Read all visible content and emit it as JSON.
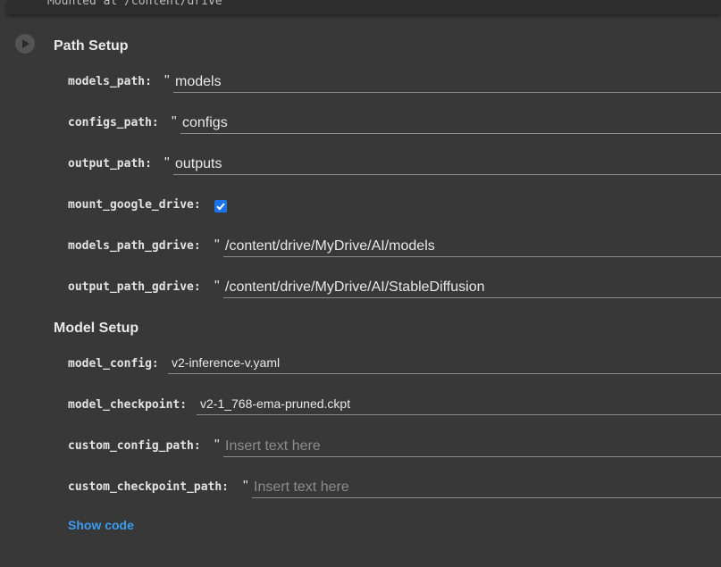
{
  "previous_output": {
    "text": "Mounted at /content/drive"
  },
  "cell": {
    "run_button_icon": "play-icon",
    "path_setup": {
      "title": "Path Setup",
      "models_path": {
        "label": "models_path:",
        "value": "models"
      },
      "configs_path": {
        "label": "configs_path:",
        "value": "configs"
      },
      "output_path": {
        "label": "output_path:",
        "value": "outputs"
      },
      "mount_google_drive": {
        "label": "mount_google_drive:",
        "checked": true
      },
      "models_path_gdrive": {
        "label": "models_path_gdrive:",
        "value": "/content/drive/MyDrive/AI/models"
      },
      "output_path_gdrive": {
        "label": "output_path_gdrive:",
        "value": "/content/drive/MyDrive/AI/StableDiffusion"
      }
    },
    "model_setup": {
      "title": "Model Setup",
      "model_config": {
        "label": "model_config:",
        "value": "v2-inference-v.yaml"
      },
      "model_checkpoint": {
        "label": "model_checkpoint:",
        "value": "v2-1_768-ema-pruned.ckpt"
      },
      "custom_config_path": {
        "label": "custom_config_path:",
        "placeholder": "Insert text here"
      },
      "custom_checkpoint_path": {
        "label": "custom_checkpoint_path:",
        "placeholder": "Insert text here"
      }
    },
    "show_code_label": "Show code",
    "quote_mark": "\""
  },
  "colors": {
    "background": "#383838",
    "accent": "#1a73e8",
    "link": "#3b9cf2"
  }
}
